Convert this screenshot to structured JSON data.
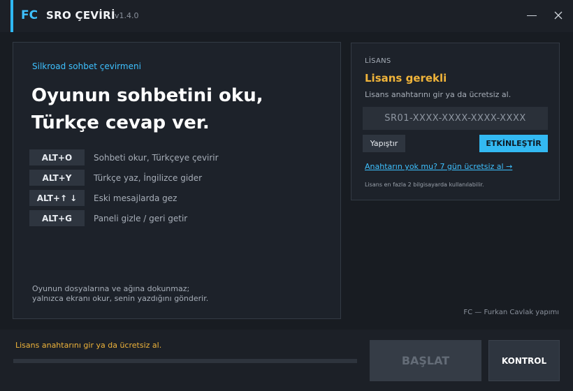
{
  "app": {
    "logo": "FC",
    "title": "SRO ÇEVİRİ",
    "version": "v1.4.0",
    "accent_color": "#2fb8f2"
  },
  "window_controls": {
    "minimize_icon": "minimize-icon",
    "close_icon": "close-icon"
  },
  "intro": {
    "tagline": "Silkroad sohbet çevirmeni",
    "headline_line1": "Oyunun sohbetini oku,",
    "headline_line2": "Türkçe cevap ver."
  },
  "shortcuts": [
    {
      "key": "ALT+O",
      "desc": "Sohbeti okur, Türkçeye çevirir"
    },
    {
      "key": "ALT+Y",
      "desc": "Türkçe yaz, İngilizce gider"
    },
    {
      "key": "ALT+↑ ↓",
      "desc": "Eski mesajlarda gez"
    },
    {
      "key": "ALT+G",
      "desc": "Paneli gizle / geri getir"
    }
  ],
  "note": {
    "line1": "Oyunun dosyalarına ve ağına dokunmaz;",
    "line2": "yalnızca ekranı okur, senin yazdığını gönderir."
  },
  "license": {
    "section_label": "LİSANS",
    "status": "Lisans gerekli",
    "status_color": "#f0b43a",
    "hint": "Lisans anahtarını gir ya da ücretsiz al.",
    "input_value": "",
    "input_placeholder": "SR01-XXXX-XXXX-XXXX-XXXX",
    "paste_label": "Yapıştır",
    "activate_label": "ETKİNLEŞTİR",
    "trial_link": "Anahtarın yok mu? 7 gün ücretsiz al →",
    "footnote": "Lisans en fazla 2 bilgisayarda kullanılabilir."
  },
  "credit": "FC — Furkan Cavlak yapımı",
  "footer": {
    "status_text": "Lisans anahtarını gir ya da ücretsiz al.",
    "progress_fraction": 0,
    "start_label": "BAŞLAT",
    "check_label": "KONTROL"
  }
}
